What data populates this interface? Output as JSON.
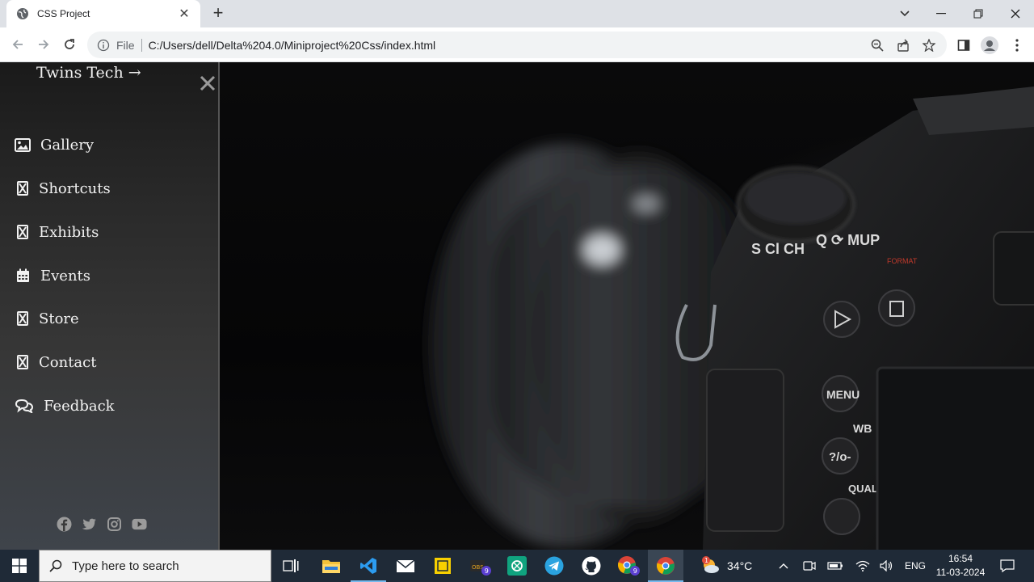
{
  "browser": {
    "tab_title": "CSS Project",
    "new_tab_symbol": "+",
    "url_scheme_label": "File",
    "url": "C:/Users/dell/Delta%204.0/Miniproject%20Css/index.html"
  },
  "page": {
    "brand": "Twins Tech →",
    "menu": [
      {
        "label": "Gallery",
        "icon": "image-icon"
      },
      {
        "label": "Shortcuts",
        "icon": "hourglass-icon"
      },
      {
        "label": "Exhibits",
        "icon": "hourglass-icon"
      },
      {
        "label": "Events",
        "icon": "calendar-icon"
      },
      {
        "label": "Store",
        "icon": "hourglass-icon"
      },
      {
        "label": "Contact",
        "icon": "hourglass-icon"
      },
      {
        "label": "Feedback",
        "icon": "comments-icon"
      }
    ],
    "socials": [
      "facebook-icon",
      "twitter-icon",
      "instagram-icon",
      "youtube-icon"
    ],
    "hero_image": "dslr-camera-photo"
  },
  "taskbar": {
    "search_placeholder": "Type here to search",
    "weather_temp": "34°C",
    "weather_badge": "1",
    "language": "ENG",
    "time": "16:54",
    "date": "11-03-2024",
    "badges": {
      "obs": "9",
      "chrome_profile": "9"
    }
  },
  "colors": {
    "taskbar_bg": "#1f2a37",
    "sidebar_text": "#f2f2f2",
    "accent_blue": "#76b9ed"
  }
}
